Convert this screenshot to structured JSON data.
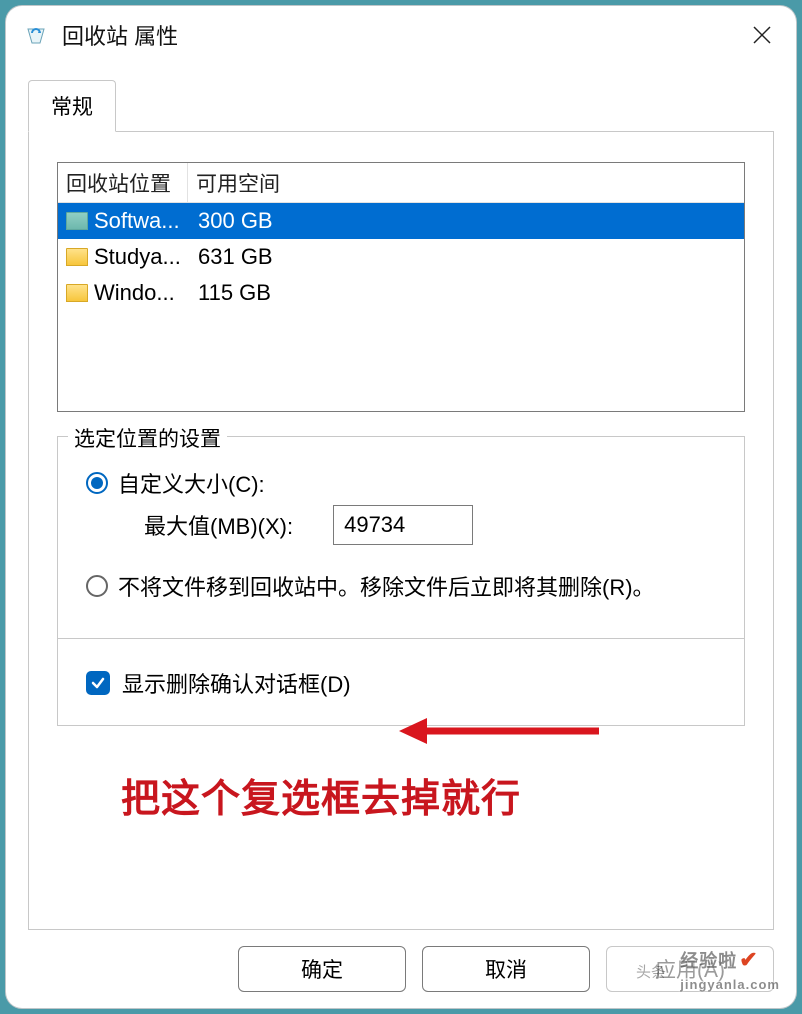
{
  "window": {
    "title": "回收站 属性"
  },
  "tabs": {
    "general": "常规"
  },
  "list": {
    "header_location": "回收站位置",
    "header_space": "可用空间",
    "rows": [
      {
        "name": "Softwa...",
        "space": "300 GB",
        "selected": true,
        "color": "teal"
      },
      {
        "name": "Studya...",
        "space": "631 GB",
        "selected": false,
        "color": "yellow"
      },
      {
        "name": "Windo...",
        "space": "115 GB",
        "selected": false,
        "color": "yellow"
      }
    ]
  },
  "settings": {
    "group_title": "选定位置的设置",
    "radio_custom": "自定义大小(C):",
    "max_label": "最大值(MB)(X):",
    "max_value": "49734",
    "radio_nodelete": "不将文件移到回收站中。移除文件后立即将其删除(R)。",
    "checkbox_confirm": "显示删除确认对话框(D)"
  },
  "annotation": {
    "caption": "把这个复选框去掉就行"
  },
  "buttons": {
    "ok": "确定",
    "cancel": "取消",
    "apply": "应用(A)"
  },
  "watermark": {
    "site": "jingyanla.com",
    "brand": "经验啦",
    "prefix": "头条"
  }
}
